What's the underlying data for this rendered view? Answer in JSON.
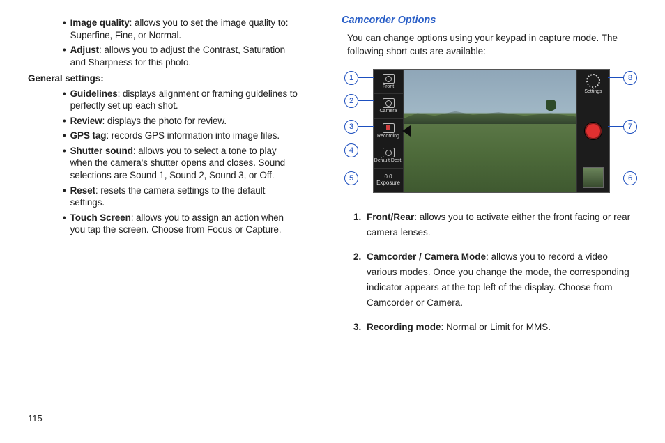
{
  "page_number": "115",
  "left": {
    "settings": [
      {
        "label": "Image quality",
        "desc": ": allows you to set the image quality to: Superfine, Fine, or Normal."
      },
      {
        "label": "Adjust",
        "desc": ": allows you to adjust the Contrast, Saturation and Sharpness for this photo."
      }
    ],
    "general_heading": "General settings",
    "general": [
      {
        "label": "Guidelines",
        "desc": ": displays alignment or framing guidelines to perfectly set up each shot."
      },
      {
        "label": "Review",
        "desc": ": displays the photo for review."
      },
      {
        "label": "GPS tag",
        "desc": ": records GPS information into image files."
      },
      {
        "label": "Shutter sound",
        "desc": ": allows you to select a tone to play when the camera's shutter opens and closes. Sound selections are Sound 1, Sound 2, Sound 3, or Off."
      },
      {
        "label": "Reset",
        "desc": ": resets the camera settings to the default settings."
      },
      {
        "label": "Touch Screen",
        "desc": ": allows you to assign an action when you tap the screen. Choose from Focus or Capture."
      }
    ]
  },
  "right": {
    "heading": "Camcorder Options",
    "intro": "You can change options using your keypad in capture mode. The following short cuts are available:",
    "callouts": {
      "c1": "1",
      "c2": "2",
      "c3": "3",
      "c4": "4",
      "c5": "5",
      "c6": "6",
      "c7": "7",
      "c8": "8"
    },
    "camui": {
      "left_labels": {
        "i1": "Front",
        "i2": "Camera",
        "i3": "Record​ing",
        "i4": "Default Dest.",
        "i5": "0.0\nExposure"
      },
      "right_labels": {
        "settings": "Settings"
      }
    },
    "list": [
      {
        "label": "Front/Rear",
        "desc": ": allows you to activate either the front facing or rear camera lenses."
      },
      {
        "label": "Camcorder / Camera Mode",
        "desc": ": allows you to record a video various modes. Once you change the mode, the corresponding indicator appears at the top left of the display. Choose from Camcorder or Camera."
      },
      {
        "label": "Recording mode",
        "desc": ": Normal or Limit for MMS."
      }
    ]
  }
}
